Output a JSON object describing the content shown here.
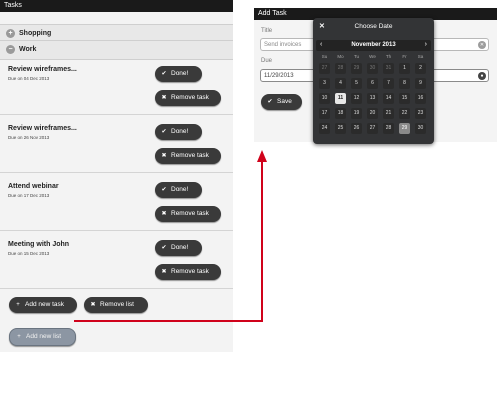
{
  "left_screen": {
    "title": "Tasks",
    "sections": [
      {
        "label": "Shopping",
        "icon": "plus-icon"
      },
      {
        "label": "Work",
        "icon": "minus-icon"
      }
    ],
    "tasks": [
      {
        "title": "Review wireframes...",
        "due": "Due on 04 Dec 2013",
        "done_label": "Done!",
        "remove_label": "Remove task"
      },
      {
        "title": "Review wireframes...",
        "due": "Due on 26 Nov 2013",
        "done_label": "Done!",
        "remove_label": "Remove task"
      },
      {
        "title": "Attend webinar",
        "due": "Due on 17 Dec 2013",
        "done_label": "Done!",
        "remove_label": "Remove task"
      },
      {
        "title": "Meeting with John",
        "due": "Due on 15 Dec 2013",
        "done_label": "Done!",
        "remove_label": "Remove task"
      }
    ],
    "add_task_label": "Add new task",
    "remove_list_label": "Remove list",
    "add_list_label": "Add new list"
  },
  "right_screen": {
    "title": "Add Task",
    "title_label": "Title",
    "title_value": "Send invoices",
    "due_label": "Due",
    "due_value": "11/29/2013",
    "save_label": "Save"
  },
  "date_picker": {
    "heading": "Choose Date",
    "month_label": "November 2013",
    "weekdays": [
      "Su",
      "Mo",
      "Tu",
      "We",
      "Th",
      "Fr",
      "Sa"
    ],
    "weeks": [
      [
        "27",
        "28",
        "29",
        "30",
        "31",
        "1",
        "2"
      ],
      [
        "3",
        "4",
        "5",
        "6",
        "7",
        "8",
        "9"
      ],
      [
        "10",
        "11",
        "12",
        "13",
        "14",
        "15",
        "16"
      ],
      [
        "17",
        "18",
        "19",
        "20",
        "21",
        "22",
        "23"
      ],
      [
        "24",
        "25",
        "26",
        "27",
        "28",
        "29",
        "30"
      ]
    ],
    "today": "11",
    "selected": "29"
  },
  "colors": {
    "connector": "#d0021b",
    "dark_button": "#3a3a3a",
    "picker_bg": "#333436"
  }
}
